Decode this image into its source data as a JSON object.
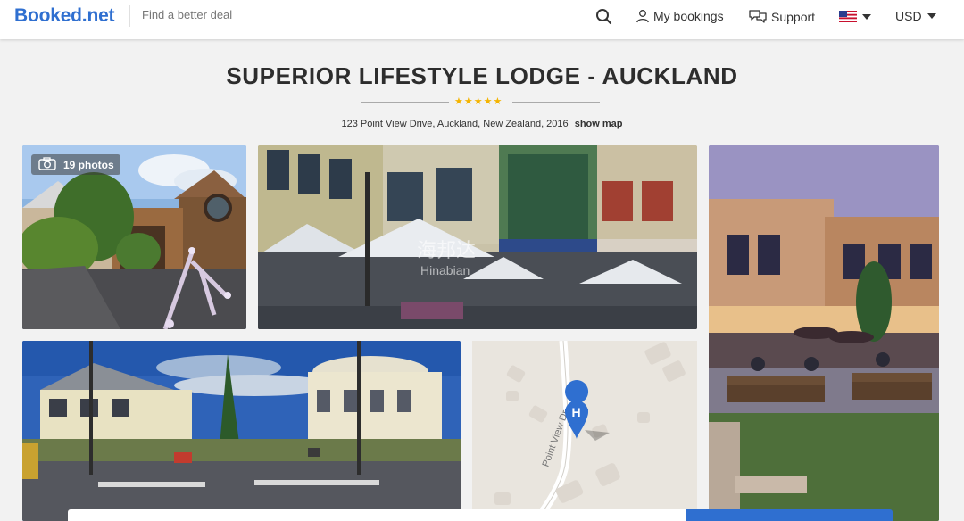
{
  "header": {
    "logo": "Booked.net",
    "tagline": "Find a better deal",
    "nav": {
      "bookings": "My bookings",
      "support": "Support",
      "currency": "USD"
    }
  },
  "hotel": {
    "title": "SUPERIOR LIFESTYLE LODGE - AUCKLAND",
    "stars": "★★★★★",
    "star_rating": 5,
    "address": "123 Point View Drive, Auckland, New Zealand, 2016",
    "show_map": "show map"
  },
  "gallery": {
    "photo_count": "19 photos",
    "watermark_cn": "海邦达",
    "watermark_en": "Hinabian"
  },
  "map": {
    "street_label": "Point View Dr",
    "marker_letter": "H"
  },
  "colors": {
    "brand": "#2f6fd0",
    "star": "#f4b400"
  }
}
